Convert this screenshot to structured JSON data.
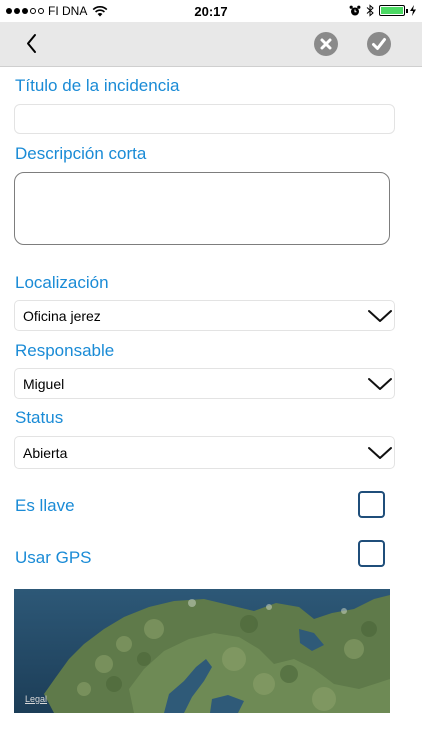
{
  "status_bar": {
    "carrier": "FI DNA",
    "time": "20:17"
  },
  "navbar": {
    "back_icon": "chevron-left-icon",
    "cancel_icon": "close-circle-icon",
    "confirm_icon": "checkmark-circle-icon"
  },
  "form": {
    "title_label": "Título de la incidencia",
    "title_value": "",
    "description_label": "Descripción corta",
    "description_value": "",
    "location_label": "Localización",
    "location_value": "Oficina jerez",
    "responsible_label": "Responsable",
    "responsible_value": "Miguel",
    "status_label": "Status",
    "status_value": "Abierta",
    "key_label": "Es llave",
    "key_checked": false,
    "gps_label": "Usar GPS",
    "gps_checked": false
  },
  "map": {
    "legal_link": "Legal"
  },
  "colors": {
    "label_blue": "#1a8bd6",
    "checkbox_border": "#1f4e7a",
    "navbar_bg": "#e8e8e8",
    "battery_green": "#4cd964"
  }
}
